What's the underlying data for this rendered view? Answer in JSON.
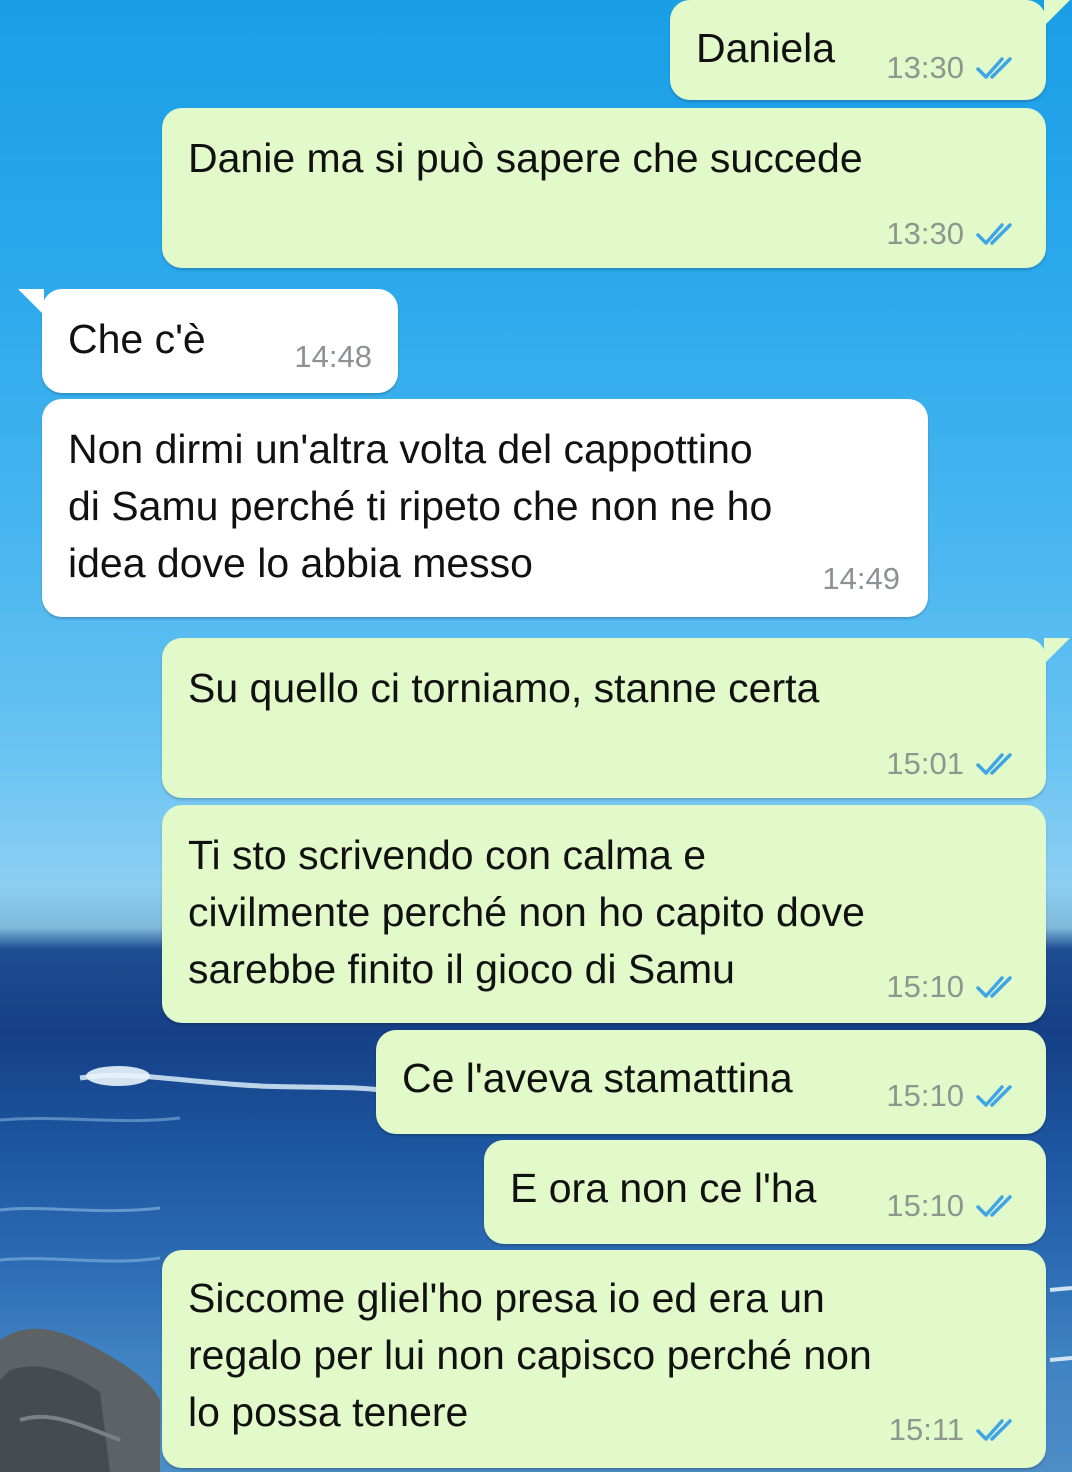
{
  "colors": {
    "outgoing_bubble": "#e2f9c9",
    "incoming_bubble": "#ffffff",
    "read_tick": "#3fa5e6",
    "timestamp": "#8a9890",
    "wallpaper_sky": "#2aa8ec",
    "wallpaper_sea": "#153f86"
  },
  "wallpaper": {
    "subject": "sea-and-sky-photo"
  },
  "messages": [
    {
      "direction": "outgoing",
      "text": "Daniela",
      "time": "13:30",
      "status_icon": "double-check-read-icon"
    },
    {
      "direction": "outgoing",
      "text": "Danie ma si può sapere che succede",
      "time": "13:30",
      "status_icon": "double-check-read-icon"
    },
    {
      "direction": "incoming",
      "text": "Che c'è",
      "time": "14:48"
    },
    {
      "direction": "incoming",
      "text": "Non dirmi un'altra volta del cappottino\ndi Samu perché ti ripeto che non ne ho\nidea dove lo abbia messo",
      "time": "14:49"
    },
    {
      "direction": "outgoing",
      "text": "Su quello ci torniamo, stanne certa",
      "time": "15:01",
      "status_icon": "double-check-read-icon"
    },
    {
      "direction": "outgoing",
      "text": "Ti sto scrivendo con calma e\ncivilmente perché non ho capito dove\nsarebbe finito il gioco di Samu",
      "time": "15:10",
      "status_icon": "double-check-read-icon"
    },
    {
      "direction": "outgoing",
      "text": "Ce l'aveva stamattina",
      "time": "15:10",
      "status_icon": "double-check-read-icon"
    },
    {
      "direction": "outgoing",
      "text": "E ora non ce l'ha",
      "time": "15:10",
      "status_icon": "double-check-read-icon"
    },
    {
      "direction": "outgoing",
      "text": "Siccome gliel'ho presa io ed era un\nregalo per lui non capisco perché non\nlo possa tenere",
      "time": "15:11",
      "status_icon": "double-check-read-icon"
    }
  ]
}
